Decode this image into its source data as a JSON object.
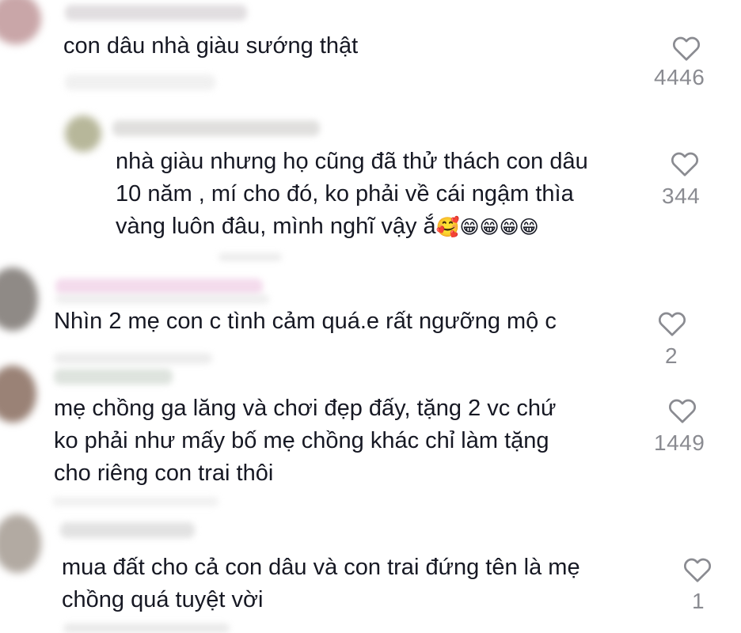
{
  "comments": [
    {
      "text": "con dâu nhà giàu sướng thật",
      "likes": "4446"
    },
    {
      "text_lines": [
        "nhà giàu nhưng họ cũng đã thử thách con dâu",
        "10 năm , mí cho đó, ko phải về cái ngậm thìa",
        "vàng luôn đâu, mình nghĩ vậy ắ"
      ],
      "emojis": "🥰😁😁😁😁",
      "likes": "344"
    },
    {
      "text": "Nhìn 2 mẹ con c tình cảm quá.e rất ngưỡng mộ c",
      "likes": "2"
    },
    {
      "text_lines": [
        "mẹ chồng ga lăng và chơi đẹp đấy, tặng 2 vc chứ",
        "ko phải như mấy bố mẹ chồng khác chỉ làm tặng",
        "cho riêng con trai thôi"
      ],
      "likes": "1449"
    },
    {
      "text_lines": [
        "mua đất cho cả con dâu và con trai đứng tên là mẹ",
        "chồng quá tuyệt vời"
      ],
      "likes": "1"
    }
  ],
  "icons": {
    "like": "heart-outline-icon"
  },
  "colors": {
    "text": "#161823",
    "count": "#8a8b91",
    "heart_stroke": "#8a8b91"
  }
}
